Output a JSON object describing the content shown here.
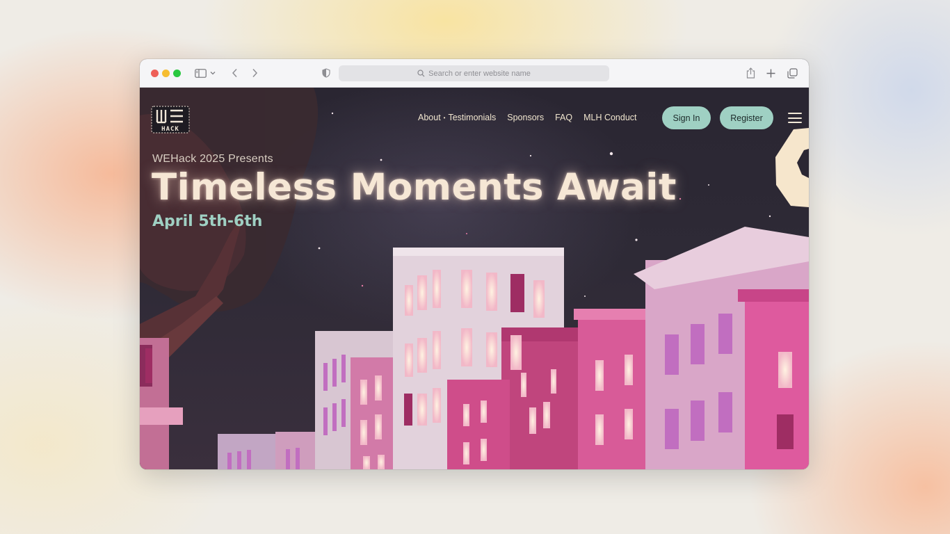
{
  "browser": {
    "address_placeholder": "Search or enter website name",
    "icons": [
      "sidebar-icon",
      "chevron-down-icon",
      "back-icon",
      "forward-icon",
      "shield-icon",
      "search-icon",
      "share-icon",
      "new-tab-icon",
      "tabs-overview-icon"
    ],
    "traffic_lights": {
      "close": "#ee5f58",
      "minimize": "#f6bd31",
      "zoom": "#29c840"
    }
  },
  "site": {
    "logo_text": "HACK",
    "nav": {
      "about": "About",
      "testimonials": "Testimonials",
      "sponsors": "Sponsors",
      "faq": "FAQ",
      "mlh_conduct": "MLH Conduct"
    },
    "sign_in": "Sign In",
    "register": "Register",
    "hero": {
      "presents": "WEHack 2025 Presents",
      "title": "Timeless Moments Await",
      "dates": "April 5th-6th"
    },
    "colors": {
      "accent_teal": "#9fd0c3",
      "headline_cream": "#f6e7d5",
      "night_sky": "#2a2632",
      "building_pink": "#c0457d"
    }
  }
}
